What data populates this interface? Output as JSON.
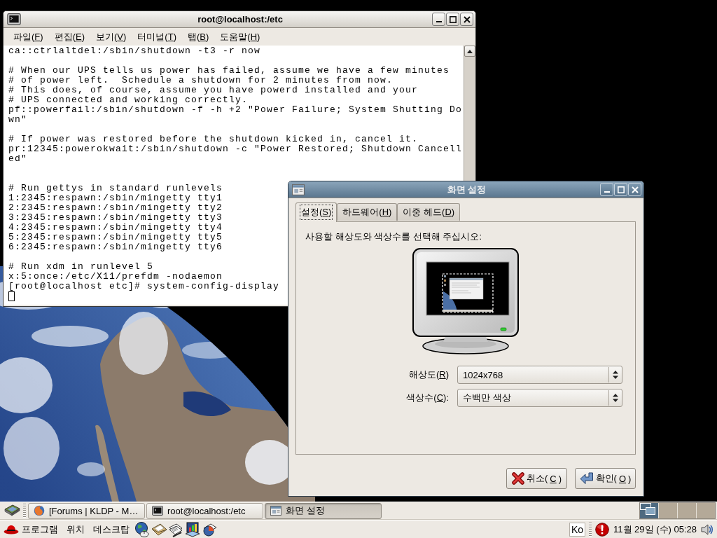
{
  "terminal": {
    "title": "root@localhost:/etc",
    "active": false,
    "menu": [
      "파일(F)",
      "편집(E)",
      "보기(V)",
      "터미널(T)",
      "탭(B)",
      "도움말(H)"
    ],
    "lines": [
      {
        "kind": "text",
        "text": "ca::ctrlaltdel:/sbin/shutdown -t3 -r now"
      },
      {
        "kind": "blank"
      },
      {
        "kind": "text",
        "text": "# When our UPS tells us power has failed, assume we have a few minutes"
      },
      {
        "kind": "text",
        "text": "# of power left.  Schedule a shutdown for 2 minutes from now."
      },
      {
        "kind": "text",
        "text": "# This does, of course, assume you have powerd installed and your"
      },
      {
        "kind": "text",
        "text": "# UPS connected and working correctly."
      },
      {
        "kind": "text",
        "text": "pf::powerfail:/sbin/shutdown -f -h +2 \"Power Failure; System Shutting Do"
      },
      {
        "kind": "text",
        "text": "wn\""
      },
      {
        "kind": "blank"
      },
      {
        "kind": "text",
        "text": "# If power was restored before the shutdown kicked in, cancel it."
      },
      {
        "kind": "text",
        "text": "pr:12345:powerokwait:/sbin/shutdown -c \"Power Restored; Shutdown Cancell"
      },
      {
        "kind": "text",
        "text": "ed\""
      },
      {
        "kind": "blank"
      },
      {
        "kind": "blank"
      },
      {
        "kind": "text",
        "text": "# Run gettys in standard runlevels"
      },
      {
        "kind": "text",
        "text": "1:2345:respawn:/sbin/mingetty tty1"
      },
      {
        "kind": "text",
        "text": "2:2345:respawn:/sbin/mingetty tty2"
      },
      {
        "kind": "text",
        "text": "3:2345:respawn:/sbin/mingetty tty3"
      },
      {
        "kind": "text",
        "text": "4:2345:respawn:/sbin/mingetty tty4"
      },
      {
        "kind": "text",
        "text": "5:2345:respawn:/sbin/mingetty tty5"
      },
      {
        "kind": "text",
        "text": "6:2345:respawn:/sbin/mingetty tty6"
      },
      {
        "kind": "blank"
      },
      {
        "kind": "text",
        "text": "# Run xdm in runlevel 5"
      },
      {
        "kind": "text",
        "text": "x:5:once:/etc/X11/prefdm -nodaemon"
      },
      {
        "kind": "text",
        "text": "[root@localhost etc]# system-config-display"
      },
      {
        "kind": "cursor"
      }
    ]
  },
  "dialog": {
    "title": "화면 설정",
    "active": true,
    "tabs": [
      {
        "label": "설정(S)",
        "selected": true
      },
      {
        "label": "하드웨어(H)",
        "selected": false
      },
      {
        "label": "이중 헤드(D)",
        "selected": false
      }
    ],
    "prompt": "사용할 해상도와 색상수를 선택해 주십시오:",
    "fields": [
      {
        "label": "해상도(R)",
        "value": "1024x768"
      },
      {
        "label": "색상수(C):",
        "value": "수백만 색상"
      }
    ],
    "buttons": [
      {
        "label": "취소(C)",
        "kind": "cancel"
      },
      {
        "label": "확인(O)",
        "kind": "ok"
      }
    ]
  },
  "taskbar": {
    "windows": [
      {
        "label": "[Forums | KLDP - M…",
        "kind": "browser",
        "selected": false
      },
      {
        "label": "root@localhost:/etc",
        "kind": "terminal",
        "selected": false
      },
      {
        "label": "화면 설정",
        "kind": "settings",
        "selected": true
      }
    ],
    "workspaces": [
      {
        "selected": true
      },
      {
        "selected": false
      },
      {
        "selected": false
      },
      {
        "selected": false
      }
    ]
  },
  "panel": {
    "menus": [
      "프로그램",
      "위치",
      "데스크탑"
    ],
    "input_method": "Ko",
    "clock": "11월 29일 (수) 05:28"
  }
}
